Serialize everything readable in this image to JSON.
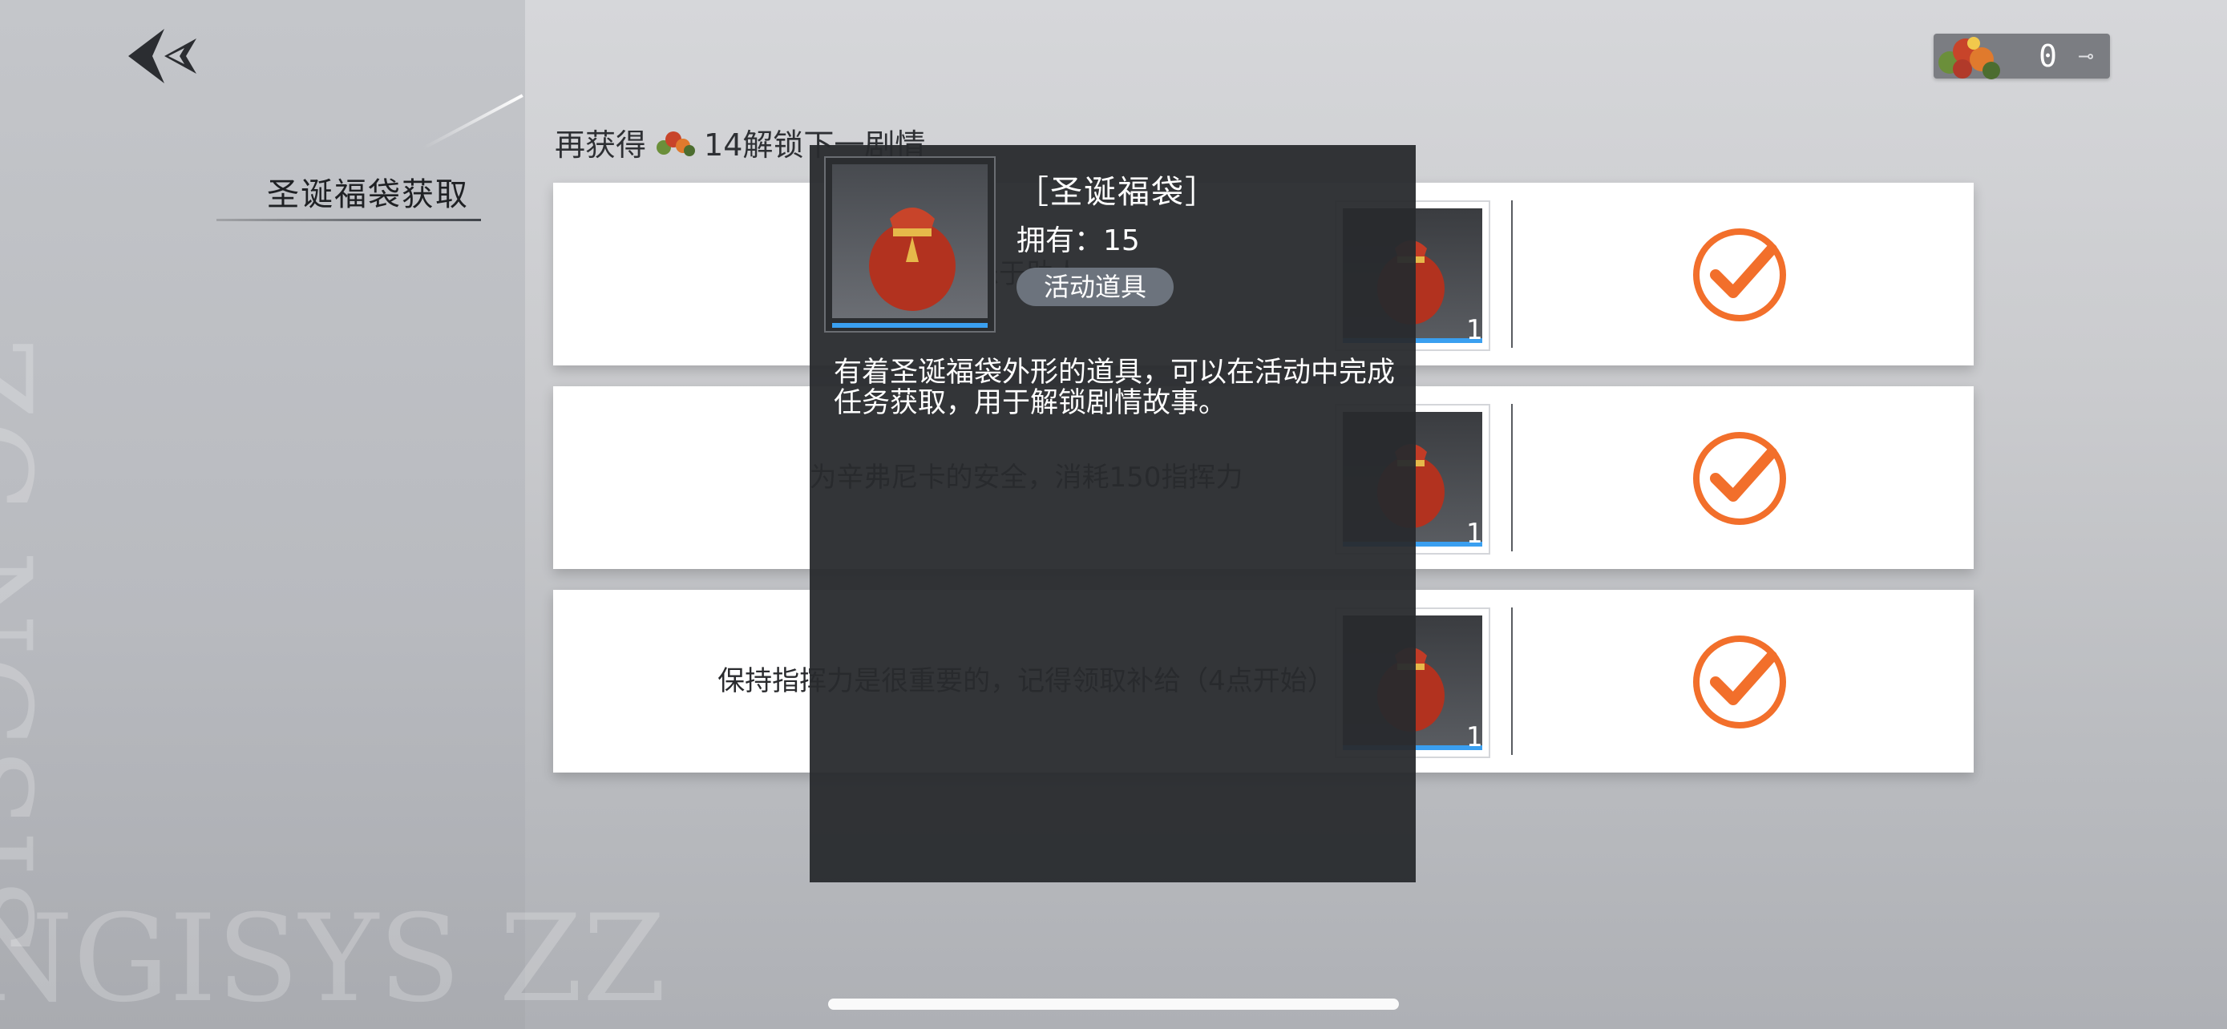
{
  "left_panel": {
    "title": "圣诞福袋获取",
    "back_icon": "back-chevron-icon"
  },
  "currency": {
    "icon": "christmas-goods-icon",
    "value": "0"
  },
  "unlock_hint": {
    "prefix": "再获得",
    "icon": "christmas-goods-icon",
    "suffix": "14解锁下一剧情"
  },
  "tasks": [
    {
      "text": "乐于助人",
      "reward_count": "1",
      "status_icon": "checkmark-circle-icon"
    },
    {
      "text": "为辛弗尼卡的安全，消耗150指挥力",
      "reward_count": "1",
      "status_icon": "checkmark-circle-icon"
    },
    {
      "text": "保持指挥力是很重要的，记得领取补给（4点开始）",
      "reward_count": "1",
      "status_icon": "checkmark-circle-icon"
    }
  ],
  "popup": {
    "name": "［圣诞福袋］",
    "owned": "拥有：15",
    "badge": "活动道具",
    "description": "有着圣诞福袋外形的道具，可以在活动中完成任务获取，用于解锁剧情故事。",
    "icon": "red-gift-bag-icon"
  },
  "colors": {
    "accent_orange": "#f26f2b",
    "reward_bar_blue": "#3a9ff0",
    "popup_bg": "#282a2d"
  }
}
